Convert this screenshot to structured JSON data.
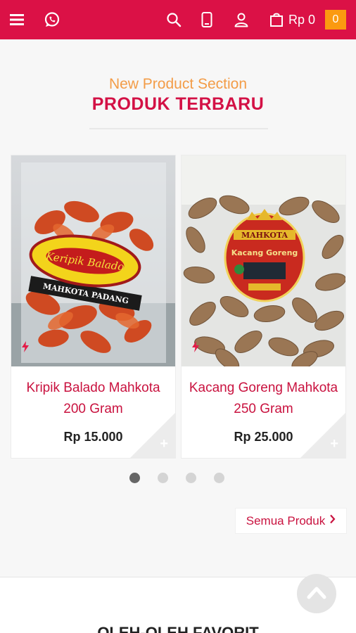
{
  "header": {
    "cart_total": "Rp 0",
    "cart_count": "0",
    "icons": [
      "menu-icon",
      "whatsapp-icon",
      "search-icon",
      "phone-icon",
      "user-icon",
      "shopping-bag-icon"
    ],
    "background": "#db1146"
  },
  "section": {
    "subtitle": "New Product Section",
    "title": "PRODUK TERBARU"
  },
  "products": [
    {
      "name": "Kripik Balado Mahkota 200 Gram",
      "price": "Rp 15.000",
      "label_line1": "Keripik Balado",
      "label_line2": "MAHKOTA PADANG"
    },
    {
      "name": "Kacang Goreng Mahkota 250 Gram",
      "price": "Rp 25.000",
      "label_line1": "MAHKOTA",
      "label_line2": "Kacang Goreng"
    }
  ],
  "carousel": {
    "page_count": 4,
    "active_page": 1
  },
  "all_products_link": "Semua Produk",
  "bottom_section": {
    "title": "OLEH-OLEH FAVORIT"
  },
  "colors": {
    "accent": "#d31145",
    "orange": "#f39c47",
    "badge": "#fb9a10"
  }
}
